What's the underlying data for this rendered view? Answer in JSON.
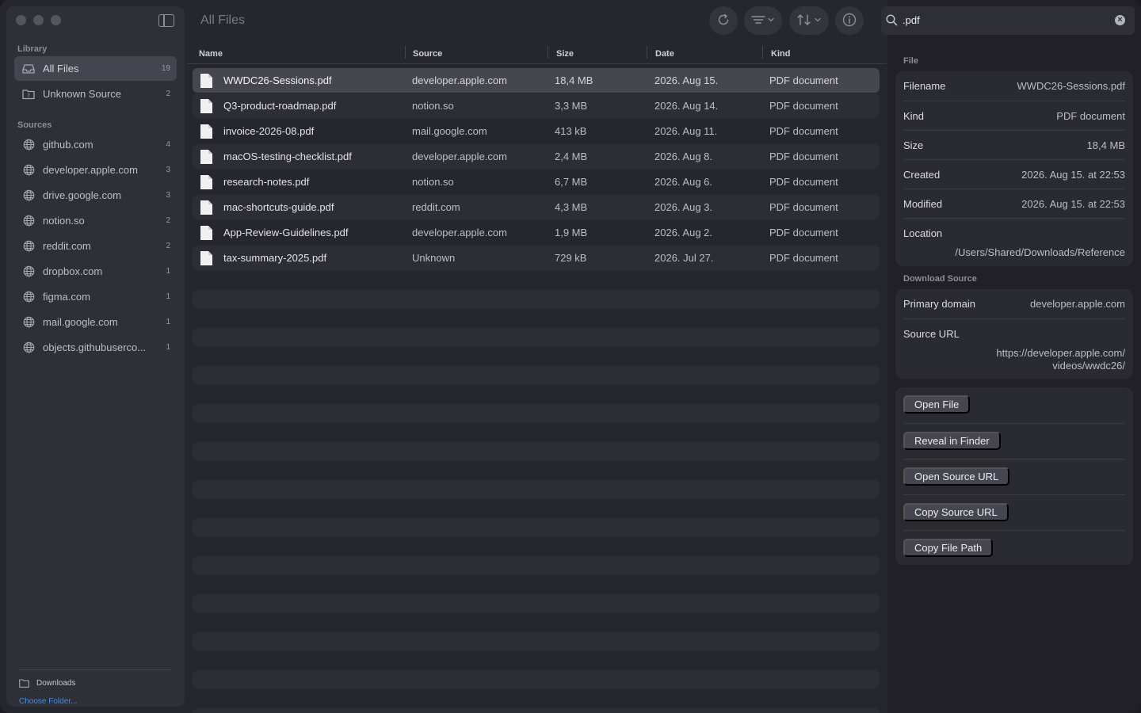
{
  "main_title": "All Files",
  "search": {
    "value": ".pdf",
    "clear_glyph": "×"
  },
  "sidebar": {
    "library_label": "Library",
    "library_items": [
      {
        "label": "All Files",
        "count": "19",
        "icon": "tray-icon",
        "active": true
      },
      {
        "label": "Unknown Source",
        "count": "2",
        "icon": "question-folder-icon",
        "active": false
      }
    ],
    "sources_label": "Sources",
    "source_items": [
      {
        "label": "github.com",
        "count": "4"
      },
      {
        "label": "developer.apple.com",
        "count": "3"
      },
      {
        "label": "drive.google.com",
        "count": "3"
      },
      {
        "label": "notion.so",
        "count": "2"
      },
      {
        "label": "reddit.com",
        "count": "2"
      },
      {
        "label": "dropbox.com",
        "count": "1"
      },
      {
        "label": "figma.com",
        "count": "1"
      },
      {
        "label": "mail.google.com",
        "count": "1"
      },
      {
        "label": "objects.githubuserco...",
        "count": "1"
      }
    ],
    "footer": {
      "folder_label": "Downloads",
      "choose_label": "Choose Folder..."
    }
  },
  "columns": {
    "name": "Name",
    "source": "Source",
    "size": "Size",
    "date": "Date",
    "kind": "Kind"
  },
  "files": [
    {
      "name": "WWDC26-Sessions.pdf",
      "source": "developer.apple.com",
      "size": "18,4 MB",
      "date": "2026. Aug 15.",
      "kind": "PDF document",
      "selected": true
    },
    {
      "name": "Q3-product-roadmap.pdf",
      "source": "notion.so",
      "size": "3,3 MB",
      "date": "2026. Aug 14.",
      "kind": "PDF document"
    },
    {
      "name": "invoice-2026-08.pdf",
      "source": "mail.google.com",
      "size": "413 kB",
      "date": "2026. Aug 11.",
      "kind": "PDF document"
    },
    {
      "name": "macOS-testing-checklist.pdf",
      "source": "developer.apple.com",
      "size": "2,4 MB",
      "date": "2026. Aug 8.",
      "kind": "PDF document"
    },
    {
      "name": "research-notes.pdf",
      "source": "notion.so",
      "size": "6,7 MB",
      "date": "2026. Aug 6.",
      "kind": "PDF document"
    },
    {
      "name": "mac-shortcuts-guide.pdf",
      "source": "reddit.com",
      "size": "4,3 MB",
      "date": "2026. Aug 3.",
      "kind": "PDF document"
    },
    {
      "name": "App-Review-Guidelines.pdf",
      "source": "developer.apple.com",
      "size": "1,9 MB",
      "date": "2026. Aug 2.",
      "kind": "PDF document"
    },
    {
      "name": "tax-summary-2025.pdf",
      "source": "Unknown",
      "size": "729 kB",
      "date": "2026. Jul 27.",
      "kind": "PDF document"
    }
  ],
  "info": {
    "file_label": "File",
    "file_rows": [
      {
        "key": "Filename",
        "value": "WWDC26-Sessions.pdf"
      },
      {
        "key": "Kind",
        "value": "PDF document"
      },
      {
        "key": "Size",
        "value": "18,4 MB"
      },
      {
        "key": "Created",
        "value": "2026. Aug 15. at 22:53"
      },
      {
        "key": "Modified",
        "value": "2026. Aug 15. at 22:53"
      }
    ],
    "location": {
      "key": "Location",
      "value": "/Users/Shared/Downloads/Reference"
    },
    "download_label": "Download Source",
    "primary_domain": {
      "key": "Primary domain",
      "value": "developer.apple.com"
    },
    "source_url": {
      "key": "Source URL",
      "line1": "https://developer.apple.com/",
      "line2": "videos/wwdc26/"
    },
    "actions": [
      "Open File",
      "Reveal in Finder",
      "Open Source URL",
      "Copy Source URL",
      "Copy File Path"
    ]
  },
  "colors": {
    "accent": "#3d8ef0",
    "selection": "#46464f",
    "window_bg": "#26262e"
  }
}
